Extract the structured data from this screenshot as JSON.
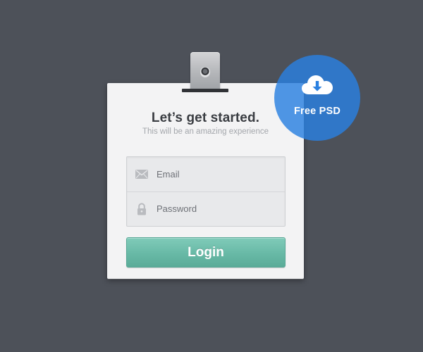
{
  "card": {
    "title": "Let’s get started.",
    "subtitle": "This will be an amazing experience"
  },
  "form": {
    "email": {
      "placeholder": "Email",
      "value": "",
      "icon": "envelope-icon"
    },
    "password": {
      "placeholder": "Password",
      "value": "",
      "icon": "lock-icon"
    },
    "login_label": "Login"
  },
  "badge": {
    "label": "Free PSD",
    "icon": "cloud-download-icon"
  },
  "colors": {
    "background": "#4d5159",
    "card": "#f3f3f4",
    "button": "#68b9a6",
    "badge": "#2a80e0"
  }
}
